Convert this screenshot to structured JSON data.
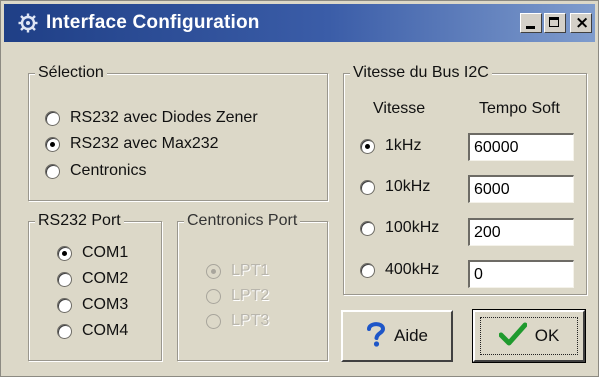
{
  "window": {
    "title": "Interface Configuration",
    "icon": "gear-icon",
    "controls": [
      "minimize-icon",
      "maximize-icon",
      "close-icon"
    ],
    "close_label": "×",
    "accent_color": "#1f3f86"
  },
  "selection": {
    "legend": "Sélection",
    "options": [
      {
        "label": "RS232 avec Diodes Zener",
        "checked": false
      },
      {
        "label": "RS232 avec Max232",
        "checked": true
      },
      {
        "label": "Centronics",
        "checked": false
      }
    ]
  },
  "rs232_port": {
    "legend": "RS232 Port",
    "options": [
      {
        "label": "COM1",
        "checked": true
      },
      {
        "label": "COM2",
        "checked": false
      },
      {
        "label": "COM3",
        "checked": false
      },
      {
        "label": "COM4",
        "checked": false
      }
    ]
  },
  "centronics_port": {
    "legend": "Centronics Port",
    "disabled": true,
    "options": [
      {
        "label": "LPT1",
        "checked": true
      },
      {
        "label": "LPT2",
        "checked": false
      },
      {
        "label": "LPT3",
        "checked": false
      }
    ]
  },
  "bus_speed": {
    "legend": "Vitesse du Bus I2C",
    "col_speed": "Vitesse",
    "col_tempo": "Tempo Soft",
    "rows": [
      {
        "label": "1kHz",
        "checked": true,
        "tempo": "60000"
      },
      {
        "label": "10kHz",
        "checked": false,
        "tempo": "6000"
      },
      {
        "label": "100kHz",
        "checked": false,
        "tempo": "200"
      },
      {
        "label": "400kHz",
        "checked": false,
        "tempo": "0"
      }
    ]
  },
  "buttons": {
    "help_label": "Aide",
    "help_icon": "question-mark-icon",
    "ok_label": "OK",
    "ok_icon": "checkmark-icon"
  }
}
